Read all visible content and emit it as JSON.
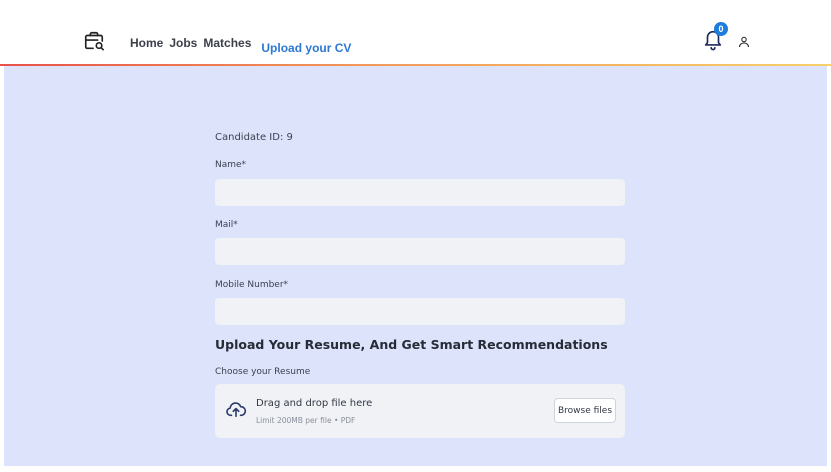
{
  "header": {
    "nav": [
      {
        "label": "Home"
      },
      {
        "label": "Jobs"
      },
      {
        "label": "Matches"
      },
      {
        "label": "Upload your CV"
      }
    ],
    "notification_count": "0",
    "icons": [
      "briefcase-search-icon",
      "bell-icon",
      "user-icon"
    ]
  },
  "form": {
    "candidate_id": "Candidate ID: 9",
    "name_label": "Name*",
    "name_value": "",
    "mail_label": "Mail*",
    "mail_value": "",
    "mobile_label": "Mobile Number*",
    "mobile_value": ""
  },
  "upload": {
    "title": "Upload Your Resume, And Get Smart Recommendations",
    "choose_label": "Choose your Resume",
    "drag_text": "Drag and drop file here",
    "limit_text": "Limit 200MB per file • PDF",
    "browse_label": "Browse files"
  },
  "colors": {
    "background": "#dde3fb",
    "active_nav": "#2c79d4",
    "badge": "#1e7ddc",
    "input_bg": "#f0f2f6"
  }
}
